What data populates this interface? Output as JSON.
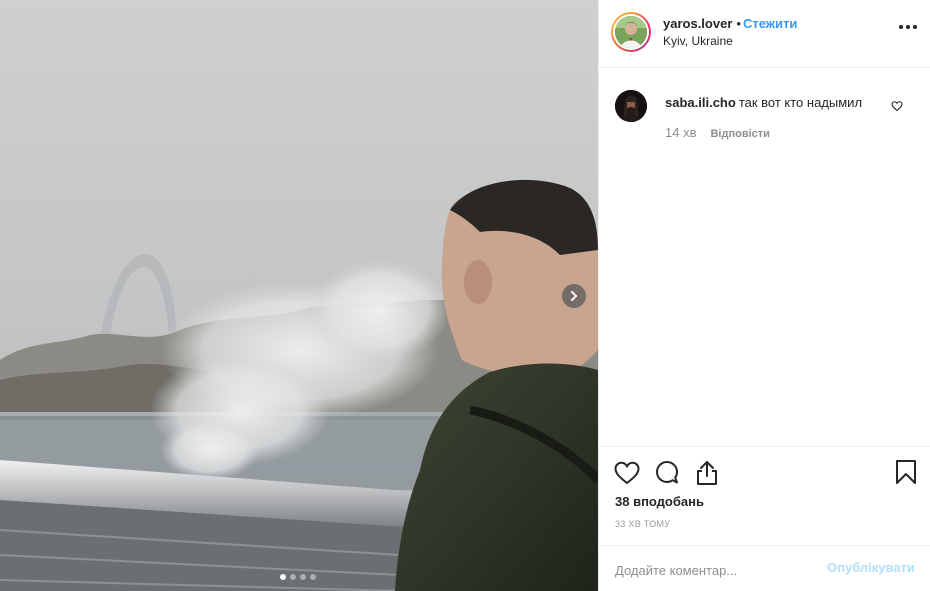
{
  "post": {
    "photo": {
      "alt_icon": "chevron-right-icon",
      "carousel_total": 4,
      "carousel_active": 1
    },
    "header": {
      "username": "yaros.lover",
      "separator": "•",
      "follow_label": "Стежити",
      "location": "Kyiv, Ukraine"
    },
    "comments": [
      {
        "username": "saba.ili.cho",
        "text": "так вот кто надымил",
        "time": "14 хв",
        "reply_label": "Відповісти"
      }
    ],
    "likes": "38 вподобань",
    "posted_ago": "33 ХВ ТОМУ",
    "add_comment": {
      "placeholder": "Додайте коментар...",
      "publish_label": "Опублікувати"
    },
    "colors": {
      "accent": "#3897f0",
      "publish_disabled": "#b2dffc",
      "text": "#262626",
      "muted": "#8e8e8e",
      "border": "#efefef"
    }
  }
}
